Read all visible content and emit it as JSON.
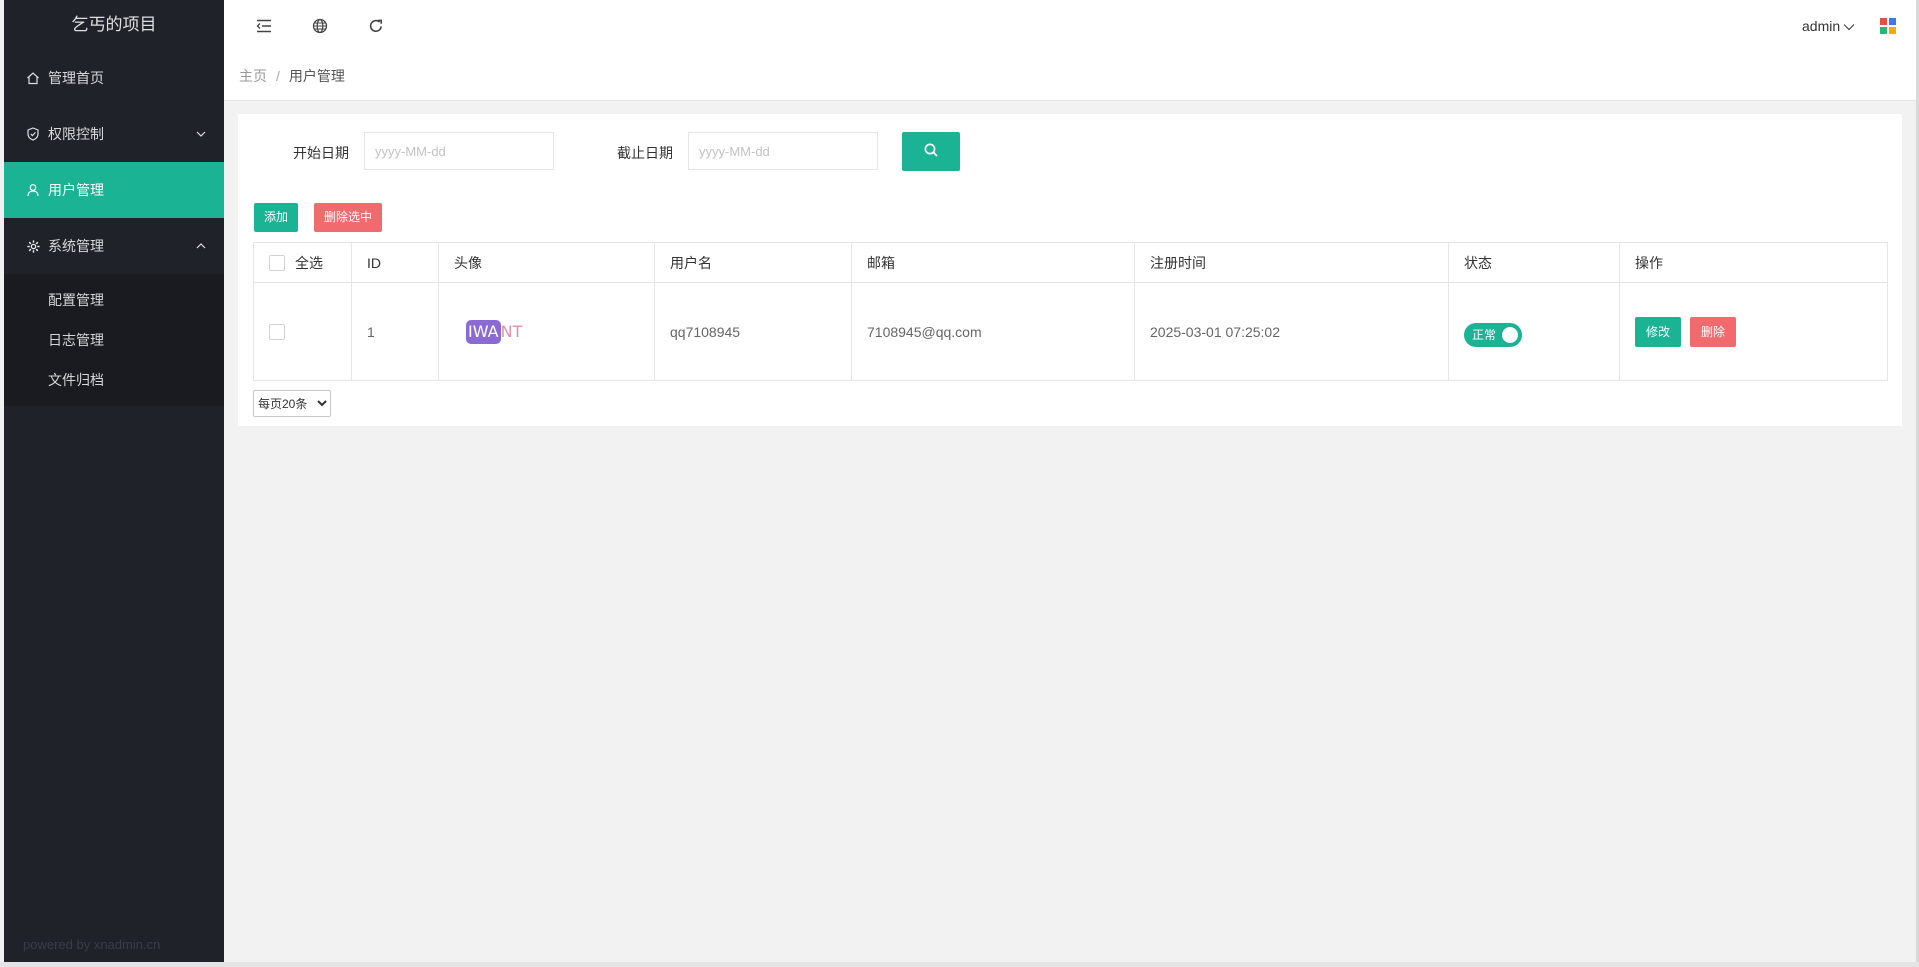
{
  "sidebar": {
    "logo": "乞丐的项目",
    "items": [
      {
        "label": "管理首页",
        "icon": "home-icon"
      },
      {
        "label": "权限控制",
        "icon": "shield-icon"
      },
      {
        "label": "用户管理",
        "icon": "user-icon"
      },
      {
        "label": "系统管理",
        "icon": "gear-icon"
      }
    ],
    "submenu": [
      "配置管理",
      "日志管理",
      "文件归档"
    ],
    "powered": "powered by xnadmin.cn",
    "active_color": "#1ab394"
  },
  "topbar": {
    "icons": [
      "menu-fold-icon",
      "globe-icon",
      "refresh-icon"
    ],
    "user": "admin"
  },
  "breadcrumb": {
    "home": "主页",
    "separator": "/",
    "current": "用户管理"
  },
  "search": {
    "start_label": "开始日期",
    "start_placeholder": "yyyy-MM-dd",
    "end_label": "截止日期",
    "end_placeholder": "yyyy-MM-dd"
  },
  "actions": {
    "add": "添加",
    "delete_selected": "删除选中"
  },
  "table": {
    "headers": {
      "select_all": "全选",
      "id": "ID",
      "avatar": "头像",
      "username": "用户名",
      "email": "邮箱",
      "register_time": "注册时间",
      "status": "状态",
      "operation": "操作"
    },
    "rows": [
      {
        "id": "1",
        "avatar_text_highlight": "IWA",
        "avatar_text_rest": "NT",
        "username": "qq7108945",
        "email": "7108945@qq.com",
        "register_time": "2025-03-01 07:25:02",
        "status": "正常",
        "edit": "修改",
        "delete": "删除"
      }
    ]
  },
  "pagination": {
    "page_size": "每页20条"
  },
  "colors": {
    "primary": "#1ab394",
    "danger": "#f16a6e",
    "sidebar": "#20222a"
  }
}
